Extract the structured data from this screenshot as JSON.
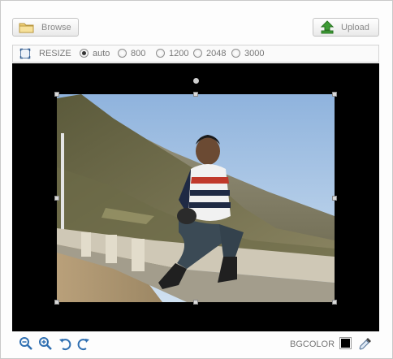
{
  "toolbar": {
    "browse_label": "Browse",
    "upload_label": "Upload",
    "resize_label": "RESIZE",
    "options": [
      {
        "label": "auto",
        "checked": true
      },
      {
        "label": "800",
        "checked": false
      },
      {
        "label": "1200",
        "checked": false
      },
      {
        "label": "2048",
        "checked": false
      },
      {
        "label": "3000",
        "checked": false
      }
    ]
  },
  "canvas": {
    "background": "#000000",
    "image_subject": "man sitting on a stone wall in the mountains"
  },
  "bottom": {
    "bgcolor_label": "BGCOLOR",
    "bgcolor_value": "#000000",
    "tools": [
      "zoom-out-icon",
      "zoom-in-icon",
      "rotate-left-icon",
      "rotate-right-icon"
    ]
  },
  "colors": {
    "accent_green": "#3d9b35",
    "tool_blue": "#2f6fb1"
  }
}
